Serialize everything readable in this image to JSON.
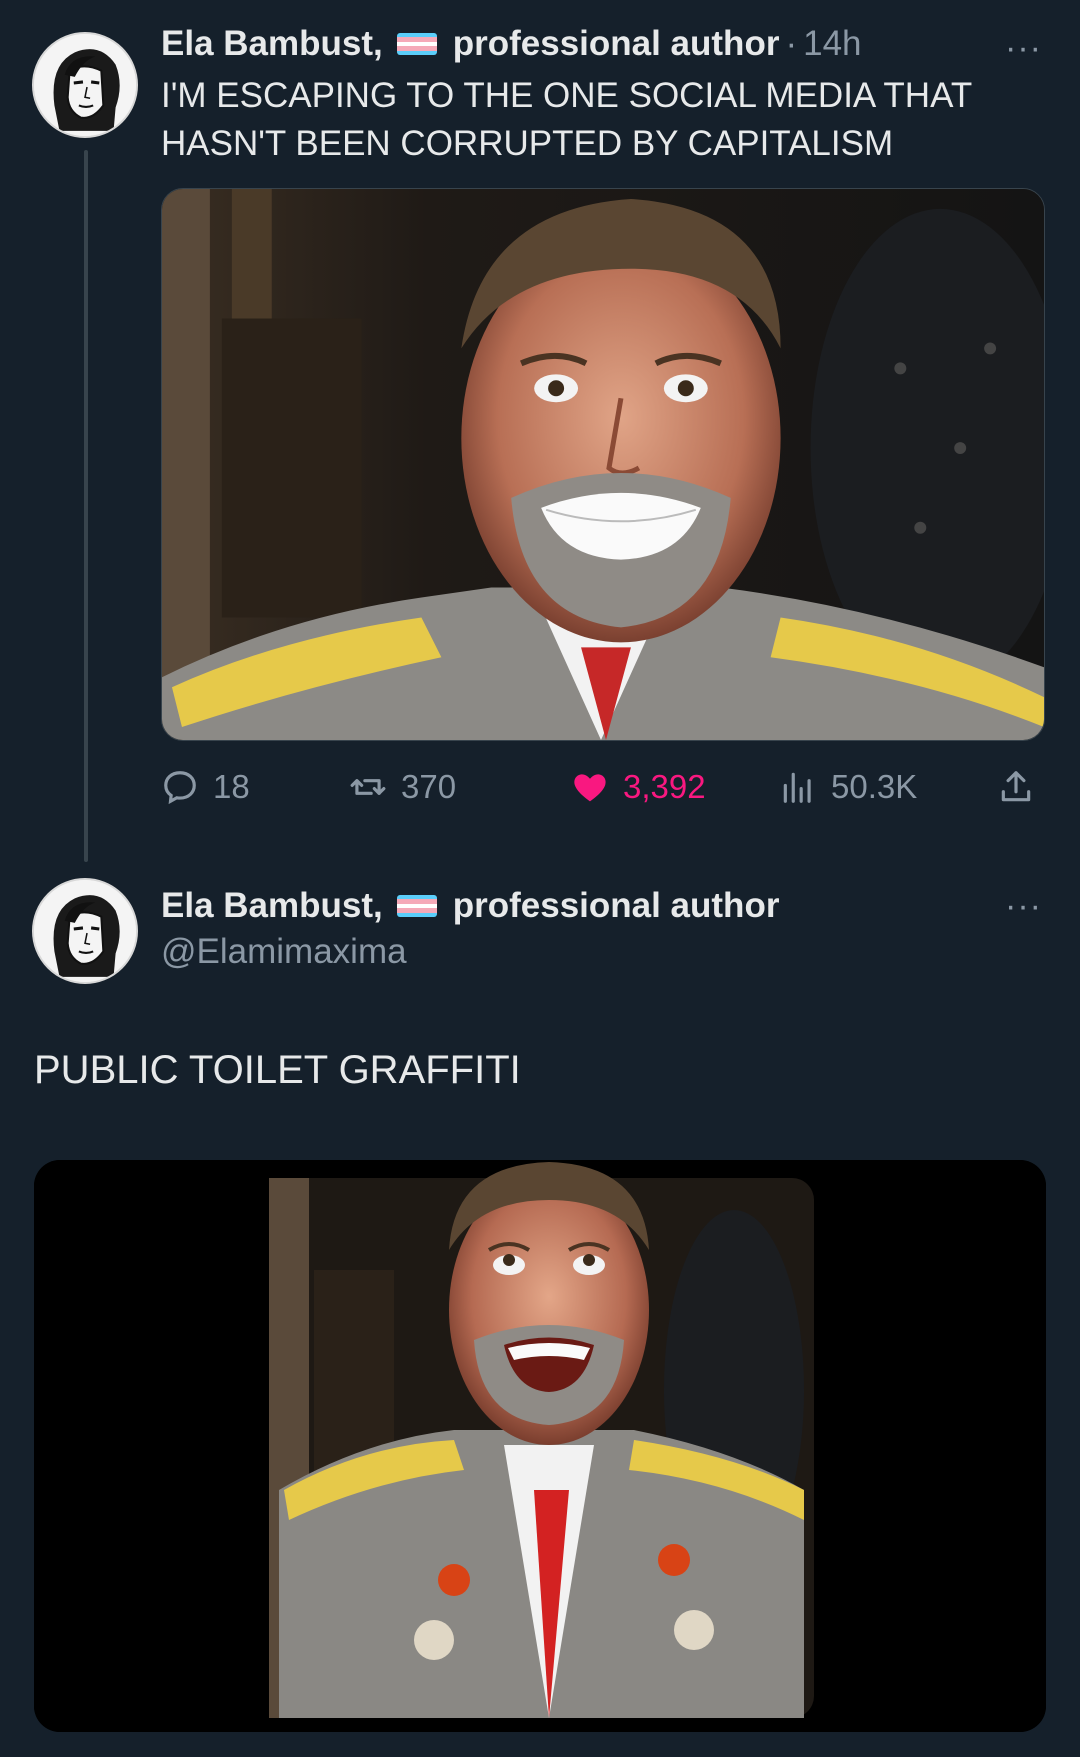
{
  "tweet1": {
    "author_name": "Ela Bambust,",
    "author_title": "professional author",
    "separator": "·",
    "time": "14h",
    "more_label": "···",
    "text_line1": "I'M ESCAPING TO THE ONE SOCIAL MEDIA THAT",
    "text_line2": "HASN'T BEEN CORRUPTED BY CAPITALISM",
    "stats": {
      "replies": "18",
      "retweets": "370",
      "likes": "3,392",
      "views": "50.3K"
    }
  },
  "tweet2": {
    "author_name": "Ela Bambust,",
    "author_title": "professional author",
    "handle": "@Elamimaxima",
    "more_label": "···",
    "text": "PUBLIC TOILET GRAFFITI"
  },
  "colors": {
    "background": "#15202b",
    "text": "#e7e9ea",
    "muted": "#8b98a5",
    "like": "#f91880",
    "flag_blue": "#5bcefa",
    "flag_pink": "#f5a9b8",
    "flag_white": "#ffffff"
  },
  "icons": [
    "reply-icon",
    "retweet-icon",
    "like-heart-icon",
    "views-icon",
    "share-icon",
    "more-icon"
  ]
}
